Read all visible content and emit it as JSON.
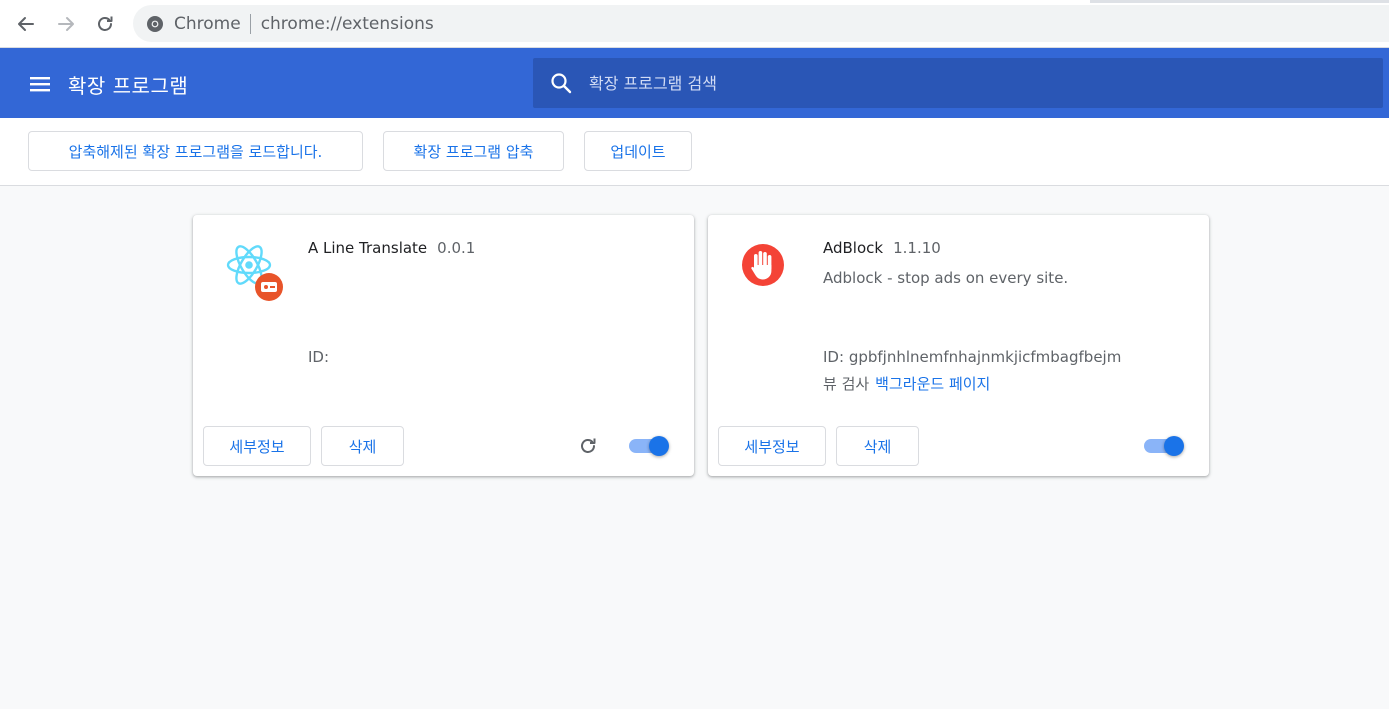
{
  "browser": {
    "scheme_label": "Chrome",
    "url": "chrome://extensions"
  },
  "header": {
    "title": "확장 프로그램",
    "search_placeholder": "확장 프로그램 검색"
  },
  "toolbar": {
    "load_unpacked": "압축해제된 확장 프로그램을 로드합니다.",
    "pack_extension": "확장 프로그램 압축",
    "update": "업데이트"
  },
  "extensions": [
    {
      "name": "A Line Translate",
      "version": "0.0.1",
      "description": "",
      "id_label": "ID:",
      "id_value": "",
      "details_label": "세부정보",
      "remove_label": "삭제",
      "enabled": true,
      "has_reload": true
    },
    {
      "name": "AdBlock",
      "version": "1.1.10",
      "description": "Adblock - stop ads on every site.",
      "id_label": "ID:",
      "id_value": "gpbfjnhlnemfnhajnmkjicfmbagfbejm",
      "views_label": "뷰 검사",
      "views_link": "백그라운드 페이지",
      "details_label": "세부정보",
      "remove_label": "삭제",
      "enabled": true,
      "has_reload": false
    }
  ],
  "colors": {
    "header_blue": "#3367d6",
    "accent": "#1a73e8",
    "react_icon": "#61dafb",
    "badge_orange": "#e8542a",
    "adblock_red": "#f44336"
  },
  "icons": {
    "back": "arrow-left-icon",
    "forward": "arrow-right-icon",
    "reload": "reload-icon",
    "menu": "hamburger-menu-icon",
    "search": "search-icon"
  }
}
